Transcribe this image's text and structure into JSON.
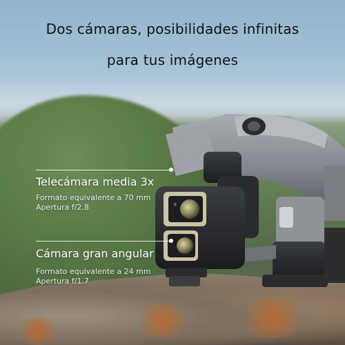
{
  "headline": {
    "line1": "Dos cámaras, posibilidades infinitas",
    "line2": "para tus imágenes"
  },
  "callouts": [
    {
      "title": "Telecámara media 3x",
      "format": "Formato equivalente a 70 mm",
      "aperture": "Apertura f/2.8"
    },
    {
      "title": "Cámara gran angular",
      "format": "Formato equivalente a 24 mm",
      "aperture": "Apertura f/1.7"
    }
  ],
  "icons": {
    "logo": "dji-logo-icon"
  }
}
